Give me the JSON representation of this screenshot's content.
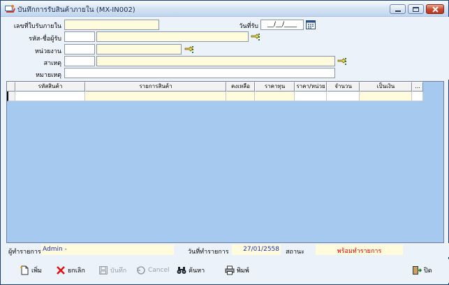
{
  "window": {
    "title": "บันทึกการรับสินค้าภายใน (MX-IN002)"
  },
  "form": {
    "doc_no_label": "เลขที่ใบรับภายใน",
    "doc_no_value": "",
    "receive_date_label": "วันที่รับ",
    "receive_date_value": "__/__/____",
    "receiver_label": "รหัส-ชื่อผู้รับ",
    "receiver_code": "",
    "receiver_name": "",
    "department_label": "หน่วยงาน",
    "department_code": "",
    "department_name": "",
    "reason_label": "สาเหตุ",
    "reason_code": "",
    "reason_name": "",
    "note_label": "หมายเหตุ",
    "note_value": ""
  },
  "grid": {
    "columns": [
      "",
      "รหัสสินค้า",
      "รายการสินค้า",
      "คงเหลือ",
      "ราคาทุน",
      "ราคา/หน่วย",
      "จำนวน",
      "เป็นเงิน",
      "..."
    ]
  },
  "status": {
    "operator_label": "ผู้ทำรายการ",
    "operator_value": "Admin -",
    "date_label": "วันที่ทำรายการ",
    "date_value": "27/01/2558",
    "state_label": "สถานะ",
    "state_value": "พร้อมทำรายการ",
    "state_color": "#e00000",
    "value_color": "#1a2fb4"
  },
  "toolbar": {
    "add": "เพิ่ม",
    "cancel_doc": "ยกเลิก",
    "save": "บันทึก",
    "cancel": "Cancel",
    "search": "ค้นหา",
    "print": "พิมพ์",
    "close": "ปิด"
  }
}
